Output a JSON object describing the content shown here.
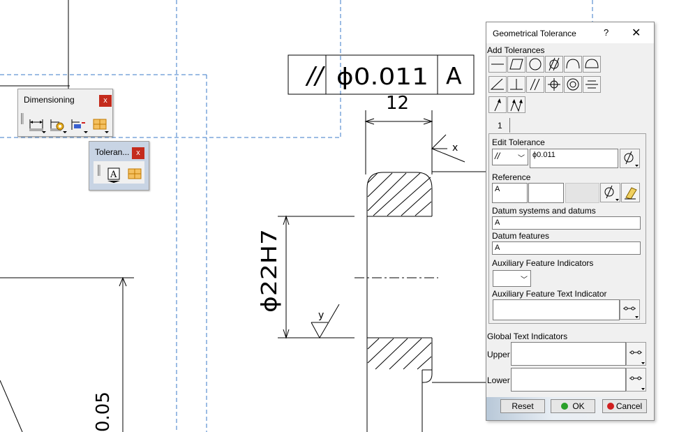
{
  "drawing": {
    "fcf_symbol": "//",
    "fcf_tolerance": "ϕ0.011",
    "fcf_datum": "A",
    "dim_width": "12",
    "dim_diameter": "ϕ22H7",
    "dim_partial": "0.05",
    "roughness_x": "x",
    "roughness_y": "y"
  },
  "toolbars": {
    "dimensioning": {
      "title": "Dimensioning",
      "close": "x"
    },
    "tolerancing": {
      "title": "Toleran...",
      "close": "x"
    }
  },
  "dialog": {
    "title": "Geometrical Tolerance",
    "help": "?",
    "close": "✕",
    "add_tolerances": "Add Tolerances",
    "tab": "1",
    "edit_tolerance": "Edit Tolerance",
    "tolerance_type": "//",
    "tolerance_value": "ϕ0.011",
    "reference": "Reference",
    "reference_value": "A",
    "datum_systems_label": "Datum systems and datums",
    "datum_systems_value": "A",
    "datum_features_label": "Datum features",
    "datum_features_value": "A",
    "aux_indicators_label": "Auxiliary Feature Indicators",
    "aux_text_label": "Auxiliary Feature Text Indicator",
    "global_text": "Global Text Indicators",
    "upper": "Upper",
    "lower": "Lower",
    "reset": "Reset",
    "ok": "OK",
    "cancel": "Cancel"
  },
  "icons": [
    "straightness-icon",
    "flatness-icon",
    "circularity-icon",
    "cylindricity-icon",
    "line-profile-icon",
    "surface-profile-icon",
    "angularity-icon",
    "perpendicularity-icon",
    "parallelism-icon",
    "position-icon",
    "concentricity-icon",
    "symmetry-icon",
    "circular-runout-icon",
    "total-runout-icon"
  ],
  "colors": {
    "guide_blue": "#3a78c8",
    "ok_green": "#2aa02a",
    "cancel_red": "#d02020",
    "close_red": "#c42b1c"
  }
}
